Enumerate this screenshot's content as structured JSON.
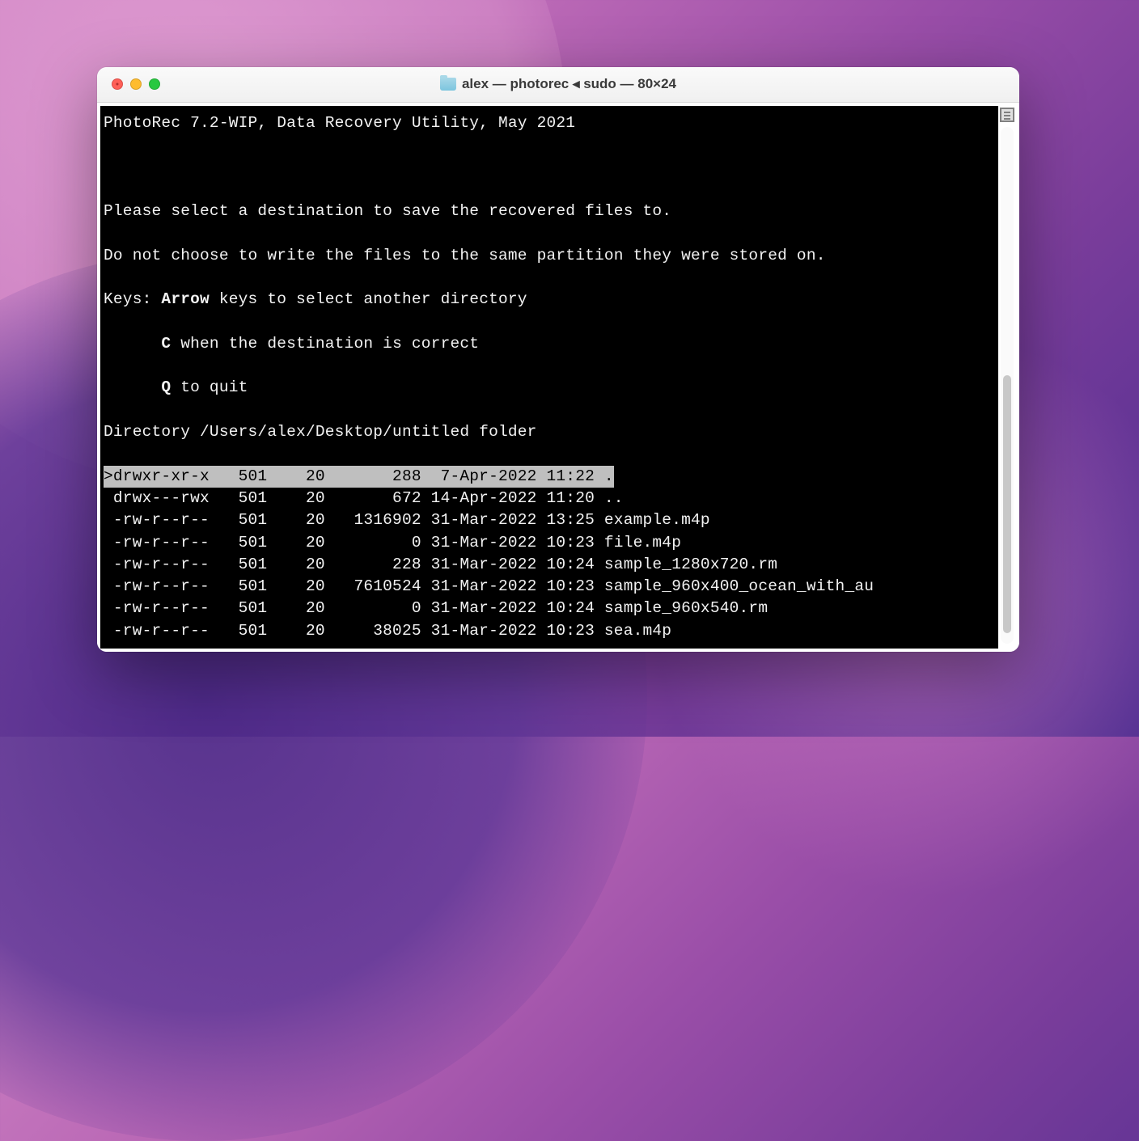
{
  "window": {
    "title": "alex — photorec ◂ sudo — 80×24"
  },
  "terminal": {
    "header": "PhotoRec 7.2-WIP, Data Recovery Utility, May 2021",
    "prompt1": "Please select a destination to save the recovered files to.",
    "prompt2": "Do not choose to write the files to the same partition they were stored on.",
    "keys_label": "Keys: ",
    "keys_arrow_bold": "Arrow",
    "keys_arrow_rest": " keys to select another directory",
    "keys_c_bold": "C",
    "keys_c_rest": " when the destination is correct",
    "keys_q_bold": "Q",
    "keys_q_rest": " to quit",
    "keys_indent": "      ",
    "dir_label": "Directory /Users/alex/Desktop/untitled folder",
    "listing": [
      {
        "selected": true,
        "line": ">drwxr-xr-x   501    20       288  7-Apr-2022 11:22 ."
      },
      {
        "selected": false,
        "line": " drwx---rwx   501    20       672 14-Apr-2022 11:20 .."
      },
      {
        "selected": false,
        "line": " -rw-r--r--   501    20   1316902 31-Mar-2022 13:25 example.m4p"
      },
      {
        "selected": false,
        "line": " -rw-r--r--   501    20         0 31-Mar-2022 10:23 file.m4p"
      },
      {
        "selected": false,
        "line": " -rw-r--r--   501    20       228 31-Mar-2022 10:24 sample_1280x720.rm"
      },
      {
        "selected": false,
        "line": " -rw-r--r--   501    20   7610524 31-Mar-2022 10:23 sample_960x400_ocean_with_au"
      },
      {
        "selected": false,
        "line": " -rw-r--r--   501    20         0 31-Mar-2022 10:24 sample_960x540.rm"
      },
      {
        "selected": false,
        "line": " -rw-r--r--   501    20     38025 31-Mar-2022 10:23 sea.m4p"
      }
    ]
  }
}
